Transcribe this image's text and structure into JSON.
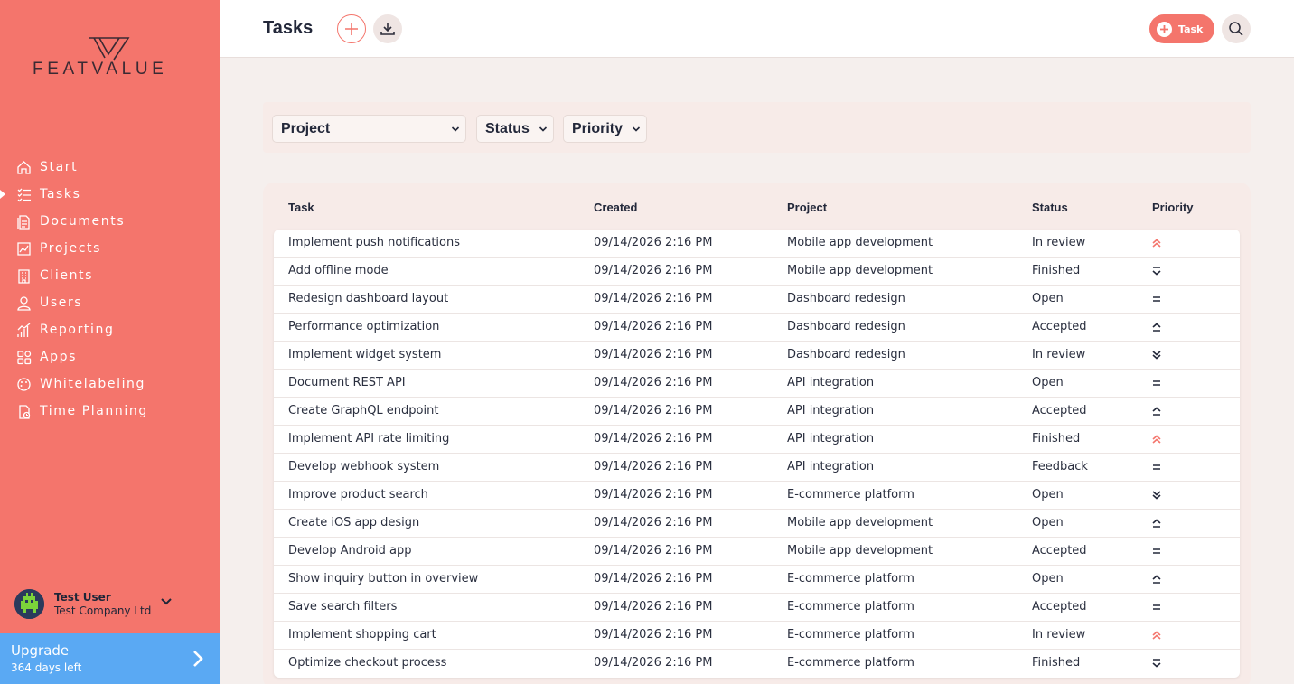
{
  "app": {
    "logo_text": "FEATVALUE"
  },
  "sidebar": {
    "items": [
      {
        "label": "Start",
        "icon": "home-icon"
      },
      {
        "label": "Tasks",
        "icon": "tasks-icon",
        "active": true
      },
      {
        "label": "Documents",
        "icon": "documents-icon"
      },
      {
        "label": "Projects",
        "icon": "projects-icon"
      },
      {
        "label": "Clients",
        "icon": "clients-icon"
      },
      {
        "label": "Users",
        "icon": "users-icon"
      },
      {
        "label": "Reporting",
        "icon": "reporting-icon"
      },
      {
        "label": "Apps",
        "icon": "apps-icon"
      },
      {
        "label": "Whitelabeling",
        "icon": "whitelabeling-icon"
      },
      {
        "label": "Time Planning",
        "icon": "time-planning-icon"
      }
    ],
    "user": {
      "name": "Test User",
      "company": "Test Company Ltd"
    },
    "upgrade": {
      "title": "Upgrade",
      "subtitle": "364 days left"
    }
  },
  "header": {
    "title": "Tasks",
    "task_button_label": "Task"
  },
  "filters": {
    "project": "Project",
    "status": "Status",
    "priority": "Priority"
  },
  "table": {
    "columns": {
      "task": "Task",
      "created": "Created",
      "project": "Project",
      "status": "Status",
      "priority": "Priority"
    },
    "rows": [
      {
        "task": "Implement push notifications",
        "created": "09/14/2026 2:16 PM",
        "project": "Mobile app development",
        "status": "In review",
        "priority": "highest"
      },
      {
        "task": "Add offline mode",
        "created": "09/14/2026 2:16 PM",
        "project": "Mobile app development",
        "status": "Finished",
        "priority": "low"
      },
      {
        "task": "Redesign dashboard layout",
        "created": "09/14/2026 2:16 PM",
        "project": "Dashboard redesign",
        "status": "Open",
        "priority": "medium"
      },
      {
        "task": "Performance optimization",
        "created": "09/14/2026 2:16 PM",
        "project": "Dashboard redesign",
        "status": "Accepted",
        "priority": "high"
      },
      {
        "task": "Implement widget system",
        "created": "09/14/2026 2:16 PM",
        "project": "Dashboard redesign",
        "status": "In review",
        "priority": "lowest"
      },
      {
        "task": "Document REST API",
        "created": "09/14/2026 2:16 PM",
        "project": "API integration",
        "status": "Open",
        "priority": "medium"
      },
      {
        "task": "Create GraphQL endpoint",
        "created": "09/14/2026 2:16 PM",
        "project": "API integration",
        "status": "Accepted",
        "priority": "high"
      },
      {
        "task": "Implement API rate limiting",
        "created": "09/14/2026 2:16 PM",
        "project": "API integration",
        "status": "Finished",
        "priority": "highest"
      },
      {
        "task": "Develop webhook system",
        "created": "09/14/2026 2:16 PM",
        "project": "API integration",
        "status": "Feedback",
        "priority": "medium"
      },
      {
        "task": "Improve product search",
        "created": "09/14/2026 2:16 PM",
        "project": "E-commerce platform",
        "status": "Open",
        "priority": "lowest"
      },
      {
        "task": "Create iOS app design",
        "created": "09/14/2026 2:16 PM",
        "project": "Mobile app development",
        "status": "Open",
        "priority": "high"
      },
      {
        "task": "Develop Android app",
        "created": "09/14/2026 2:16 PM",
        "project": "Mobile app development",
        "status": "Accepted",
        "priority": "medium"
      },
      {
        "task": "Show inquiry button in overview",
        "created": "09/14/2026 2:16 PM",
        "project": "E-commerce platform",
        "status": "Open",
        "priority": "high"
      },
      {
        "task": "Save search filters",
        "created": "09/14/2026 2:16 PM",
        "project": "E-commerce platform",
        "status": "Accepted",
        "priority": "medium"
      },
      {
        "task": "Implement shopping cart",
        "created": "09/14/2026 2:16 PM",
        "project": "E-commerce platform",
        "status": "In review",
        "priority": "highest"
      },
      {
        "task": "Optimize checkout process",
        "created": "09/14/2026 2:16 PM",
        "project": "E-commerce platform",
        "status": "Finished",
        "priority": "low"
      }
    ]
  },
  "colors": {
    "sidebar": "#f4756c",
    "accent": "#f4756c",
    "upgrade": "#5aa9f3",
    "dark": "#23283a"
  }
}
